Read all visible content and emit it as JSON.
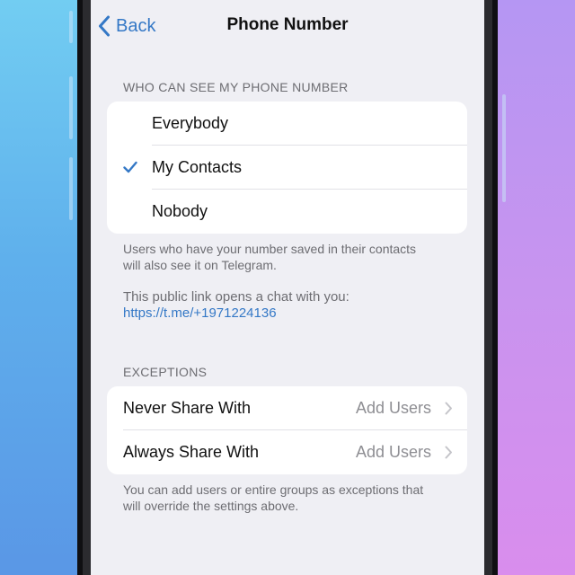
{
  "colors": {
    "accent": "#3478c6",
    "background": "#efeff4",
    "secondary_text": "#6d6d72",
    "chevron": "#c4c4c9"
  },
  "navbar": {
    "back_label": "Back",
    "title": "Phone Number"
  },
  "visibility": {
    "header": "WHO CAN SEE MY PHONE NUMBER",
    "options": [
      {
        "label": "Everybody",
        "selected": false
      },
      {
        "label": "My Contacts",
        "selected": true
      },
      {
        "label": "Nobody",
        "selected": false
      }
    ],
    "footer_line1": "Users who have your number saved in their contacts",
    "footer_line2": "will also see it on Telegram.",
    "public_link_text": "This public link opens a chat with you:",
    "public_link_url": "https://t.me/+1971224136"
  },
  "exceptions": {
    "header": "EXCEPTIONS",
    "rows": [
      {
        "label": "Never Share With",
        "value": "Add Users"
      },
      {
        "label": "Always Share With",
        "value": "Add Users"
      }
    ],
    "footer_line1": "You can add users or entire groups as exceptions that",
    "footer_line2": "will override the settings above."
  }
}
